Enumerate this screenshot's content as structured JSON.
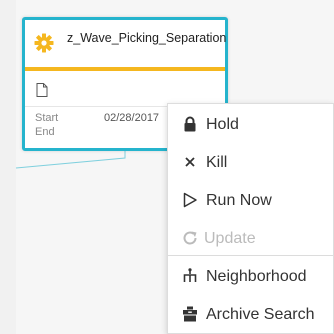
{
  "job_card": {
    "title": "z_Wave_Picking_Separation",
    "start_label": "Start",
    "end_label": "End",
    "start_date": "02/28/2017",
    "icons": {
      "status": "gear-icon",
      "detail": "document-icon"
    }
  },
  "context_menu": {
    "items": [
      {
        "label": "Hold",
        "icon": "lock-icon",
        "enabled": true
      },
      {
        "label": "Kill",
        "icon": "close-icon",
        "enabled": true
      },
      {
        "label": "Run Now",
        "icon": "play-icon",
        "enabled": true
      },
      {
        "label": "Update",
        "icon": "refresh-icon",
        "enabled": false
      },
      {
        "label": "Neighborhood",
        "icon": "hierarchy-icon",
        "enabled": true
      },
      {
        "label": "Archive Search",
        "icon": "archive-icon",
        "enabled": true
      }
    ]
  },
  "colors": {
    "card_border": "#25b4cd",
    "header_underline": "#f5b71f",
    "gear": "#f5b71f",
    "connector": "#25b4cd"
  }
}
